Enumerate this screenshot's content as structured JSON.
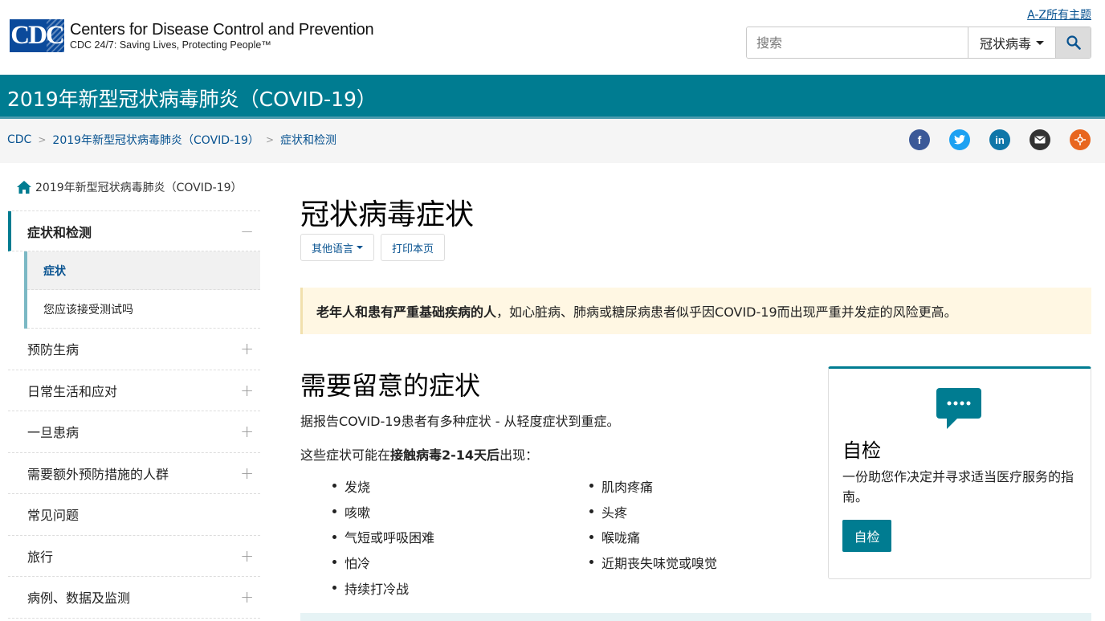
{
  "header": {
    "logo_mark": "CDC",
    "org_name": "Centers for Disease Control and Prevention",
    "tagline": "CDC 24/7: Saving Lives, Protecting People™",
    "az_link": "A-Z所有主题",
    "search_placeholder": "搜索",
    "search_scope": "冠状病毒"
  },
  "topic": {
    "title": "2019年新型冠状病毒肺炎（COVID-19）"
  },
  "breadcrumb": {
    "items": [
      "CDC",
      "2019年新型冠状病毒肺炎（COVID-19）",
      "症状和检测"
    ],
    "separator": ">"
  },
  "social": {
    "icons": [
      "facebook-icon",
      "twitter-icon",
      "linkedin-icon",
      "email-icon",
      "syndicate-icon"
    ],
    "colors": {
      "facebook": "#3b5998",
      "twitter": "#1da1f2",
      "linkedin": "#0e76a8",
      "email": "#333333",
      "syndicate": "#e8661f"
    }
  },
  "leftnav": {
    "home": "2019年新型冠状病毒肺炎（COVID-19）",
    "active_section": "症状和检测",
    "active_toggle": "−",
    "sub_items": [
      "症状",
      "您应该接受测试吗"
    ],
    "items": [
      {
        "label": "预防生病",
        "toggle": "+"
      },
      {
        "label": "日常生活和应对",
        "toggle": "+"
      },
      {
        "label": "一旦患病",
        "toggle": "+"
      },
      {
        "label": "需要额外预防措施的人群",
        "toggle": "+"
      },
      {
        "label": "常见问题",
        "toggle": ""
      },
      {
        "label": "旅行",
        "toggle": "+"
      },
      {
        "label": "病例、数据及监测",
        "toggle": "+"
      }
    ]
  },
  "main": {
    "title": "冠状病毒症状",
    "lang_button": "其他语言",
    "print_button": "打印本页",
    "alert_bold": "老年人和患有严重基础疾病的人",
    "alert_rest": "，如心脏病、肺病或糖尿病患者似乎因COVID-19而出现严重并发症的风险更高。",
    "section_title": "需要留意的症状",
    "para1": "据报告COVID-19患者有多种症状 - 从轻度症状到重症。",
    "para2_pre": "这些症状可能在",
    "para2_bold": "接触病毒2-14天后",
    "para2_post": "出现：",
    "symptoms_col1": [
      "发烧",
      "咳嗽",
      "气短或呼吸困难",
      "怕冷",
      "持续打冷战"
    ],
    "symptoms_col2": [
      "肌肉疼痛",
      "头疼",
      "喉咙痛",
      "近期丧失味觉或嗅觉"
    ]
  },
  "card": {
    "title": "自检",
    "description": "一份助您作决定并寻求适当医疗服务的指南。",
    "button": "自检"
  },
  "colors": {
    "teal": "#007c91",
    "link": "#075290",
    "alert_bg": "#fff7e3"
  }
}
